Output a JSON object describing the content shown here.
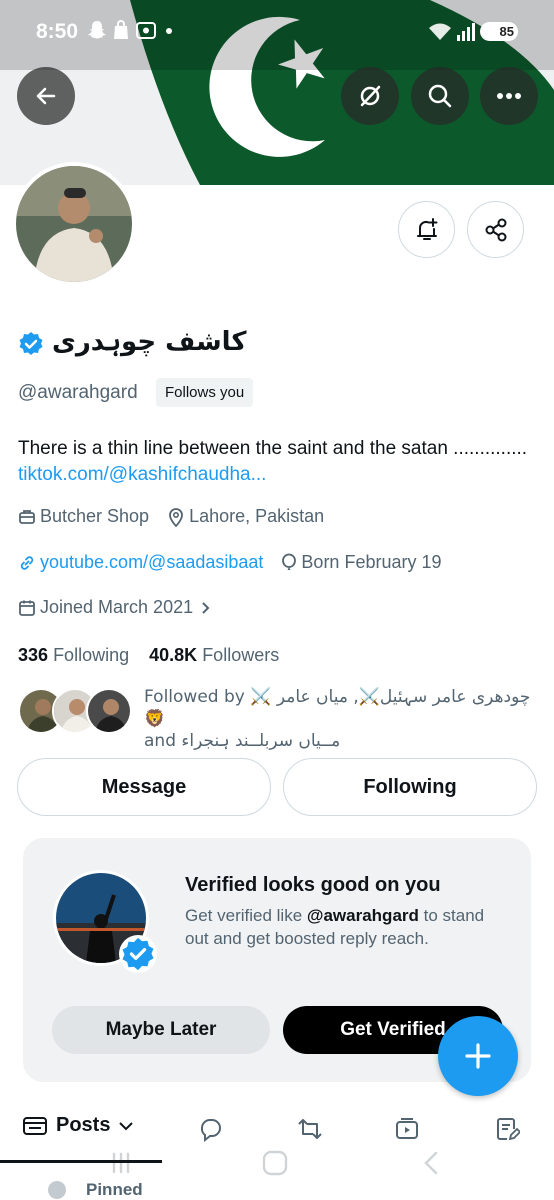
{
  "status_bar": {
    "time": "8:50",
    "battery": "85"
  },
  "profile": {
    "display_name": "کاشف چوہدری",
    "handle": "@awarahgard",
    "follows_you": "Follows you",
    "bio_text": "There is a thin line between the saint and the satan ..............",
    "bio_link": "tiktok.com/@kashifchaudha...",
    "category": "Butcher Shop",
    "location": "Lahore, Pakistan",
    "website": "youtube.com/@saadasibaat",
    "birthday": "Born February 19",
    "joined": "Joined March 2021",
    "following_count": "336",
    "following_label": "Following",
    "followers_count": "40.8K",
    "followers_label": "Followers",
    "followed_by_prefix": "Followed by",
    "followed_by_names": "⚔️ چودھری عامر سہئیل⚔️, میاں عامر 🦁",
    "followed_by_line2": "and مــیاں سربلــند ہنجراء"
  },
  "actions": {
    "message": "Message",
    "following": "Following"
  },
  "verify_card": {
    "title": "Verified looks good on you",
    "body_prefix": "Get verified like ",
    "body_handle": "@awarahgard",
    "body_suffix": " to stand out and get boosted reply reach.",
    "maybe_later": "Maybe Later",
    "get_verified": "Get Verified"
  },
  "tabs": {
    "posts": "Posts"
  },
  "pinned": "Pinned",
  "colors": {
    "accent": "#1d9bf0",
    "flag_green": "#01411c"
  },
  "icons": [
    "back-arrow-icon",
    "no-eye-icon",
    "search-icon",
    "more-icon",
    "bell-plus-icon",
    "share-icon",
    "verified-badge-icon",
    "briefcase-icon",
    "location-icon",
    "link-icon",
    "balloon-icon",
    "calendar-icon",
    "chevron-right-icon",
    "plus-icon",
    "reply-icon",
    "repost-icon",
    "media-icon",
    "articles-icon"
  ]
}
